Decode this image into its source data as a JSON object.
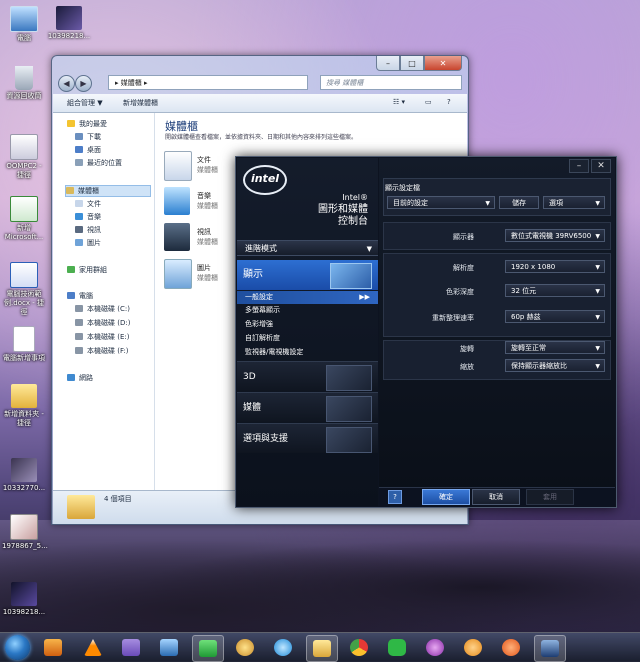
{
  "desktop": {
    "icons": [
      {
        "label": "電腦",
        "icon": "computer-icon"
      },
      {
        "label": "10398218...",
        "icon": "image-file-icon"
      },
      {
        "label": "資源回收筒",
        "icon": "recycle-bin-icon"
      },
      {
        "label": "OOMPC2 - 捷徑",
        "icon": "shortcut-icon"
      },
      {
        "label": "新增 Microsoft...",
        "icon": "excel-file-icon"
      },
      {
        "label": "電腦技術範例.docx - 捷徑",
        "icon": "word-file-icon"
      },
      {
        "label": "電腦新增事項",
        "icon": "text-file-icon"
      },
      {
        "label": "新增資料夾 - 捷徑",
        "icon": "folder-shortcut-icon"
      },
      {
        "label": "10332770...",
        "icon": "image-file-icon"
      },
      {
        "label": "1978867_5...",
        "icon": "image-file-icon"
      },
      {
        "label": "10398218...",
        "icon": "image-file-icon"
      }
    ]
  },
  "explorer": {
    "address": "媒體櫃",
    "search_placeholder": "搜尋 媒體櫃",
    "toolbar": {
      "organize": "組合管理 ▼",
      "new_library": "新增媒體櫃"
    },
    "sidebar": {
      "favorites": "我的最愛",
      "fav_items": [
        "下載",
        "桌面",
        "最近的位置"
      ],
      "libraries": "媒體櫃",
      "lib_items": [
        "文件",
        "音樂",
        "視訊",
        "圖片"
      ],
      "homegroup": "家用群組",
      "computer": "電腦",
      "drives": [
        "本機磁碟 (C:)",
        "本機磁碟 (D:)",
        "本機磁碟 (E:)",
        "本機磁碟 (F:)"
      ],
      "network": "網路"
    },
    "title": "媒體櫃",
    "subtitle": "開啟媒體櫃查看檔案，並依據資料夾、日期和其他內容來排列這些檔案。",
    "items": [
      {
        "name": "文件",
        "type": "媒體櫃"
      },
      {
        "name": "音樂",
        "type": "媒體櫃"
      },
      {
        "name": "視訊",
        "type": "媒體櫃"
      },
      {
        "name": "圖片",
        "type": "媒體櫃"
      }
    ],
    "status": "4 個項目"
  },
  "intel": {
    "logo": "intel",
    "brand_line1": "Intel®",
    "brand_line2": "圖形和媒體",
    "brand_line3": "控制台",
    "mode": "進階模式",
    "category_display": "顯示",
    "sub_items": [
      "一般設定",
      "多螢幕顯示",
      "色彩增強",
      "自訂解析度",
      "監視器/電視機設定"
    ],
    "categories": [
      "3D",
      "媒體",
      "選項與支援"
    ],
    "profile_label": "顯示設定檔",
    "profile_value": "目前的設定",
    "save_label": "儲存",
    "options_label": "選項",
    "rows": [
      {
        "label": "顯示器",
        "value": "數位式電視機 39RV6500"
      },
      {
        "label": "解析度",
        "value": "1920 x 1080"
      },
      {
        "label": "色彩深度",
        "value": "32 位元"
      },
      {
        "label": "重新整理速率",
        "value": "60p 赫茲"
      },
      {
        "label": "旋轉",
        "value": "旋轉至正常"
      },
      {
        "label": "縮放",
        "value": "保持顯示器縮放比"
      }
    ],
    "help": "?",
    "ok": "確定",
    "cancel": "取消",
    "apply": "套用"
  }
}
